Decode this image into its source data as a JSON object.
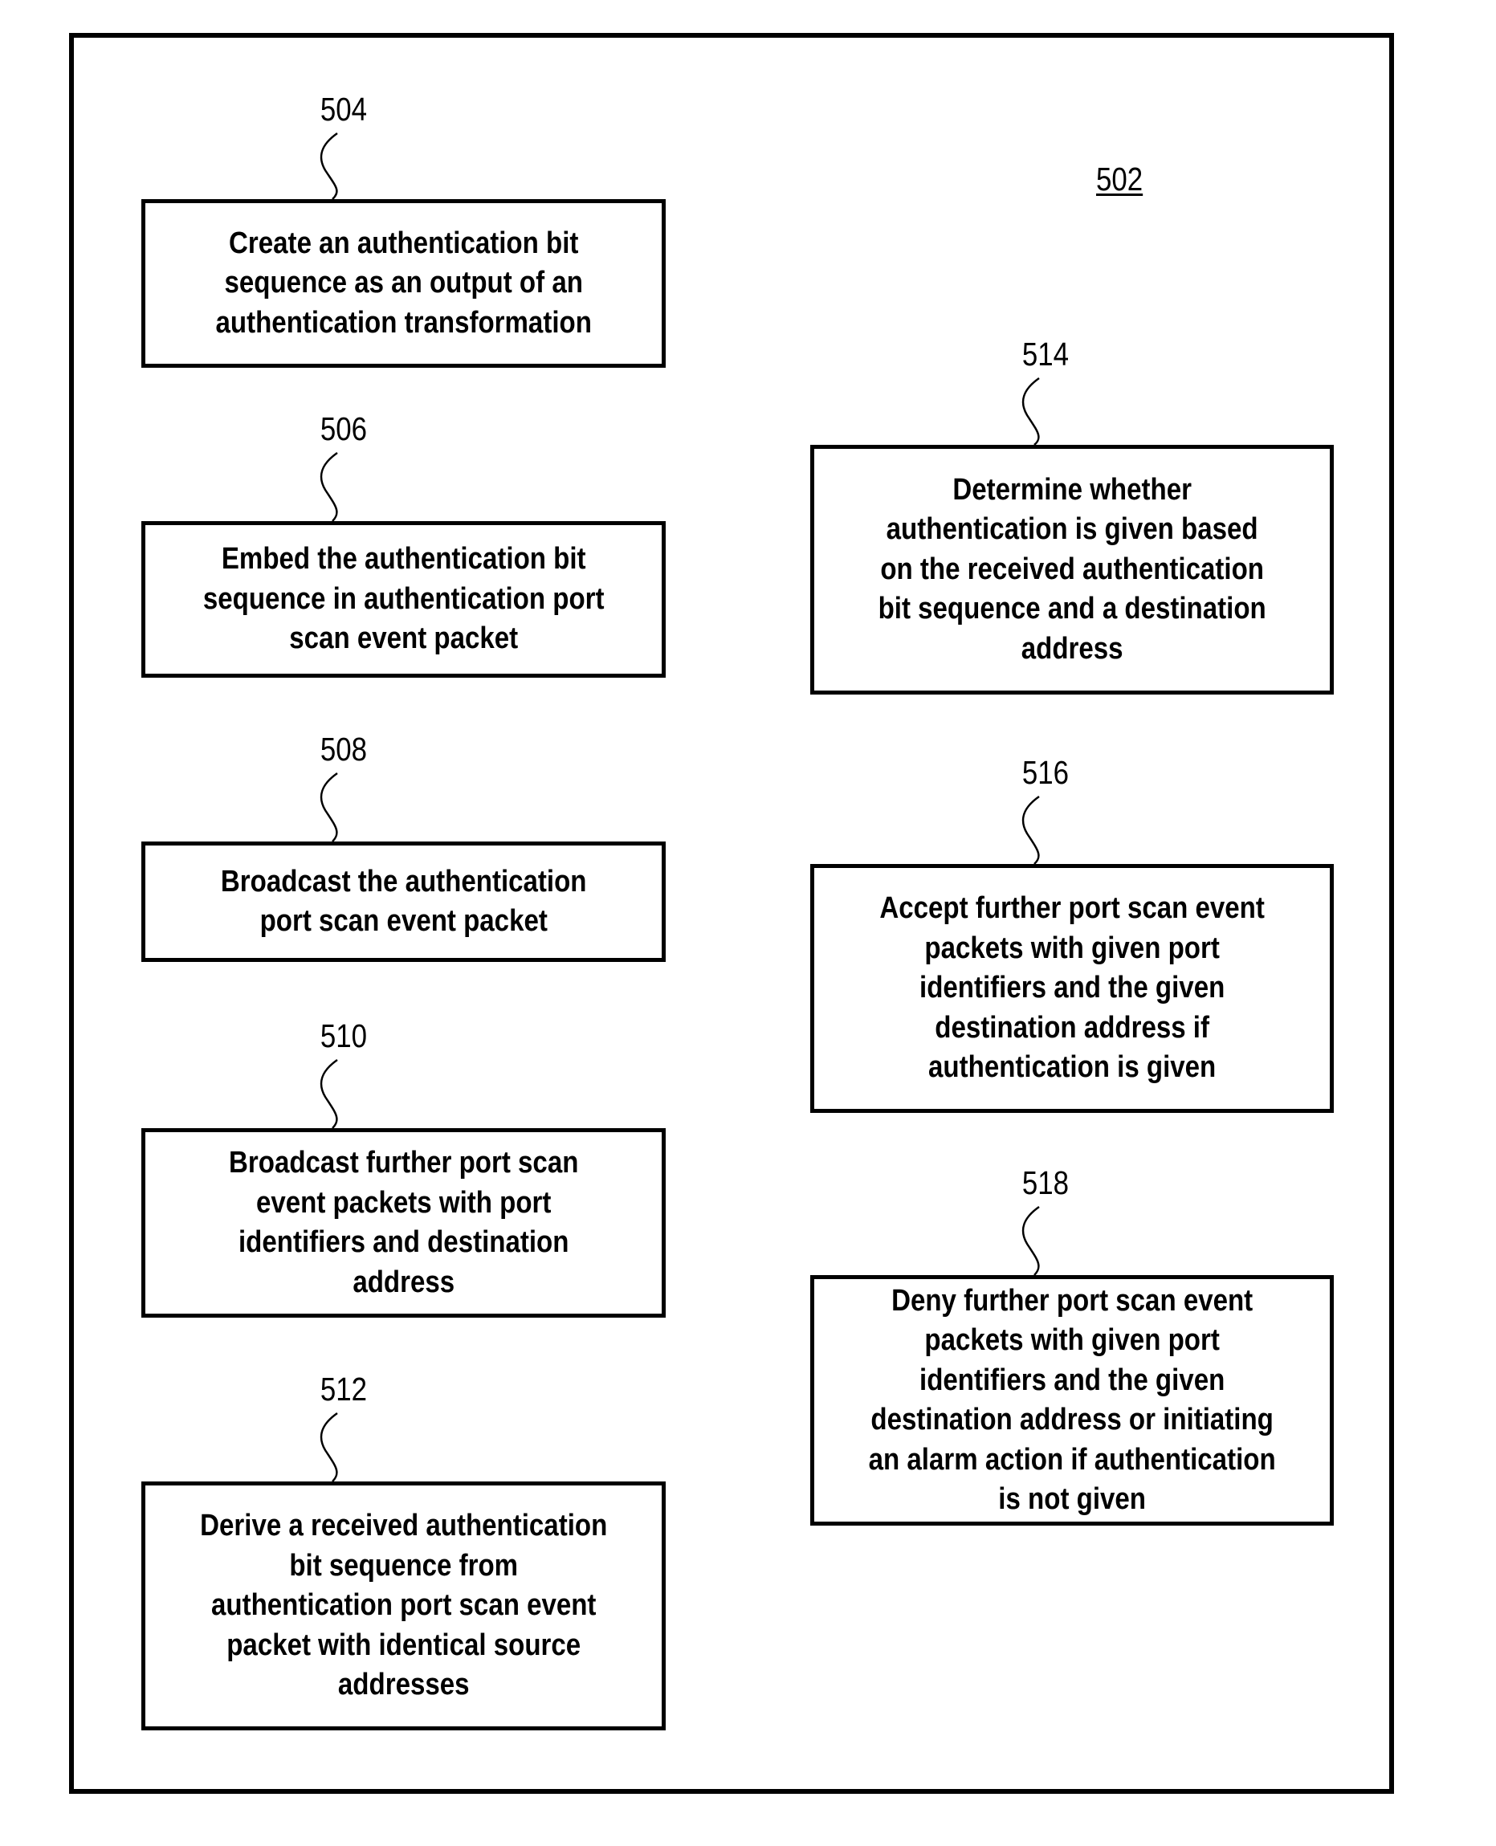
{
  "figure": {
    "label": "502"
  },
  "steps": [
    {
      "ref": "504",
      "text": "Create an authentication bit\nsequence as an output of an\nauthentication transformation"
    },
    {
      "ref": "506",
      "text": "Embed the authentication bit\nsequence in authentication port\nscan event packet"
    },
    {
      "ref": "508",
      "text": "Broadcast the authentication\nport scan event packet"
    },
    {
      "ref": "510",
      "text": "Broadcast further port scan\nevent packets with port\nidentifiers and destination\naddress"
    },
    {
      "ref": "512",
      "text": "Derive a received authentication\nbit sequence from\nauthentication port scan event\npacket with identical source\naddresses"
    },
    {
      "ref": "514",
      "text": "Determine whether\nauthentication is given based\non the received authentication\nbit sequence and a destination\naddress"
    },
    {
      "ref": "516",
      "text": "Accept further port scan event\npackets with given port\nidentifiers and the given\ndestination address if\nauthentication is given"
    },
    {
      "ref": "518",
      "text": "Deny further port scan event\npackets with given port\nidentifiers and the given\ndestination address or initiating\nan alarm action if authentication\nis not given"
    }
  ]
}
